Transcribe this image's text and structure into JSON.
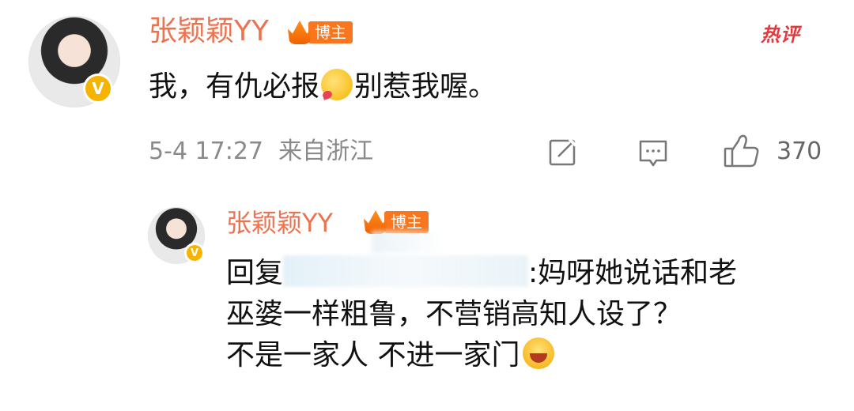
{
  "comment": {
    "username": "张颖颖YY",
    "badge_label": "博主",
    "hot_tag": "热评",
    "text_before_emoji": "我，有仇必报",
    "text_after_emoji": "别惹我喔。",
    "date": "5-4 17:27",
    "location": "来自浙江",
    "like_count": "370"
  },
  "reply": {
    "username": "张颖颖YY",
    "badge_label": "博主",
    "line1_prefix": "回复",
    "line1_suffix": ":妈呀她说话和老",
    "line2": "巫婆一样粗鲁，不营销高知人设了？",
    "line3": "不是一家人 不进一家门"
  },
  "icons": {
    "edit": "edit-icon",
    "comment": "comment-icon",
    "like": "thumbs-up-icon",
    "verified": "verified-v-icon",
    "crown": "crown-icon"
  },
  "colors": {
    "username": "#eb7350",
    "badge": "#f9761f",
    "hot": "#e4393c",
    "verified": "#f6b400"
  }
}
